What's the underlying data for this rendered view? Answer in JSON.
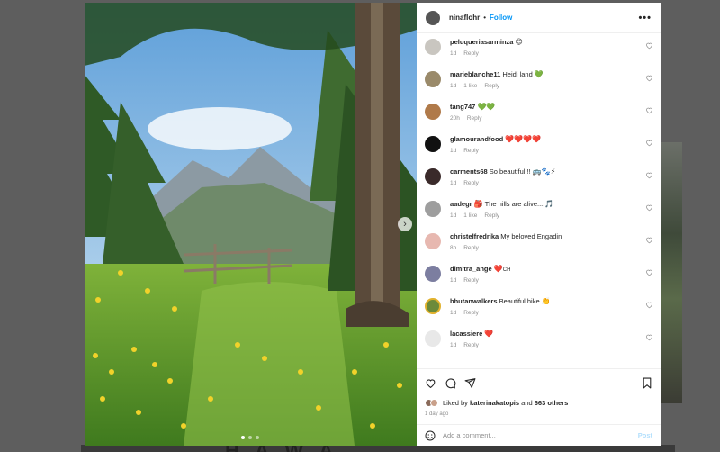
{
  "post": {
    "author": "ninaflohr",
    "separator": "•",
    "follow_label": "Follow",
    "more_label": "•••",
    "next_label": "›"
  },
  "comments": [
    {
      "user": "peluqueriasarminza",
      "text": "",
      "emoji": "😍",
      "time": "1d",
      "likes": "",
      "reply": "Reply",
      "avatar_color": "#c9c6c0"
    },
    {
      "user": "marieblanche11",
      "text": "Heidi land",
      "emoji": "💚",
      "time": "1d",
      "likes": "1 like",
      "reply": "Reply",
      "avatar_color": "#9a8a6a"
    },
    {
      "user": "tang747",
      "text": "",
      "emoji": "💚💚",
      "time": "20h",
      "likes": "",
      "reply": "Reply",
      "avatar_color": "#b07a4a"
    },
    {
      "user": "glamourandfood",
      "text": "",
      "emoji": "❤️❤️❤️❤️",
      "time": "1d",
      "likes": "",
      "reply": "Reply",
      "avatar_color": "#111111"
    },
    {
      "user": "carments68",
      "text": "So beautiful!!!",
      "emoji": "🚌🐾⚡",
      "time": "1d",
      "likes": "",
      "reply": "Reply",
      "avatar_color": "#3a2a2a"
    },
    {
      "user": "aadegr",
      "text": "The hills are alive....",
      "emoji": "🎵",
      "prefix_emoji": "🎒",
      "time": "1d",
      "likes": "1 like",
      "reply": "Reply",
      "avatar_color": "#9e9e9e"
    },
    {
      "user": "christelfredrika",
      "text": "My beloved Engadin",
      "emoji": "",
      "time": "8h",
      "likes": "",
      "reply": "Reply",
      "avatar_color": "#e7b8b0"
    },
    {
      "user": "dimitra_ange",
      "text": "",
      "emoji": "❤️",
      "suffix": "CH",
      "time": "1d",
      "likes": "",
      "reply": "Reply",
      "avatar_color": "#7c7ea0"
    },
    {
      "user": "bhutanwalkers",
      "text": "Beautiful hike",
      "emoji": "👏",
      "time": "1d",
      "likes": "",
      "reply": "Reply",
      "avatar_color": "#6c8a3a"
    },
    {
      "user": "lacassiere",
      "text": "",
      "emoji": "❤️",
      "time": "1d",
      "likes": "",
      "reply": "Reply",
      "avatar_color": "#e8e8e8"
    }
  ],
  "footer": {
    "liked_by_prefix": "Liked by",
    "liked_by_user": "katerinakatopis",
    "liked_by_and": "and",
    "others": "663 others",
    "time_ago": "1 day ago",
    "add_comment_placeholder": "Add a comment...",
    "post_label": "Post"
  },
  "background": {
    "bottom_text": "H A W A"
  },
  "colors": {
    "accent": "#0095f6",
    "post_disabled": "#b2dffc",
    "text": "#262626",
    "muted": "#8e8e8e"
  },
  "icons": [
    "heart-icon",
    "comment-icon",
    "share-icon",
    "bookmark-icon",
    "emoji-icon",
    "more-icon",
    "chevron-right-icon"
  ]
}
